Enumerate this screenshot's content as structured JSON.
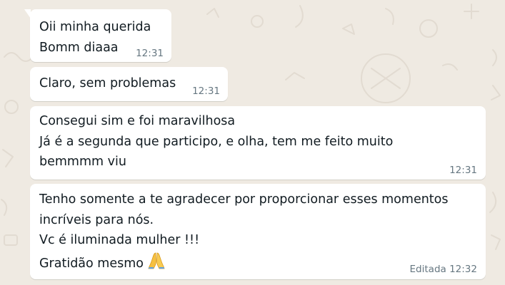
{
  "chat": {
    "messages": [
      {
        "lines": "Oii minha querida\nBomm diaaa",
        "time": "12:31"
      },
      {
        "lines": "Claro, sem problemas",
        "time": "12:31"
      },
      {
        "lines": "Consegui sim e foi maravilhosa\nJá é a segunda que participo, e olha, tem me feito muito\nbemmmm viu",
        "time": "12:31"
      },
      {
        "lines": "Tenho somente a te agradecer por proporcionar esses momentos\nincríveis para nós.\nVc é iluminada mulher !!!\nGratidão  mesmo",
        "time": "Editada 12:32",
        "emoji": "folded-hands-icon"
      }
    ]
  },
  "colors": {
    "background": "#efeae2",
    "bubble": "#ffffff",
    "text": "#111b21",
    "meta": "#667781"
  }
}
